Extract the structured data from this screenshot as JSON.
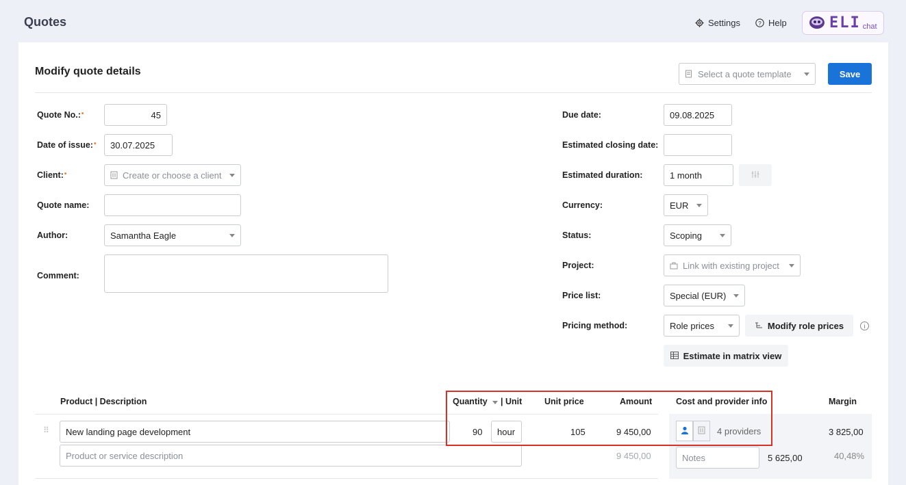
{
  "header": {
    "title": "Quotes",
    "settings_label": "Settings",
    "help_label": "Help",
    "eli_logo_text": "ELI",
    "eli_chat_label": "chat"
  },
  "form": {
    "title": "Modify quote details",
    "template_select_placeholder": "Select a quote template",
    "save_label": "Save",
    "quote_no_label": "Quote No.:",
    "quote_no_value": "45",
    "date_of_issue_label": "Date of issue:",
    "date_of_issue_value": "30.07.2025",
    "client_label": "Client:",
    "client_placeholder": "Create or choose a client",
    "quote_name_label": "Quote name:",
    "quote_name_value": "",
    "author_label": "Author:",
    "author_value": "Samantha Eagle",
    "comment_label": "Comment:",
    "comment_value": "",
    "due_date_label": "Due date:",
    "due_date_value": "09.08.2025",
    "est_closing_label": "Estimated closing date:",
    "est_closing_value": "",
    "est_duration_label": "Estimated duration:",
    "est_duration_value": "1 month",
    "currency_label": "Currency:",
    "currency_value": "EUR",
    "status_label": "Status:",
    "status_value": "Scoping",
    "project_label": "Project:",
    "project_placeholder": "Link with existing project",
    "price_list_label": "Price list:",
    "price_list_value": "Special (EUR)",
    "pricing_method_label": "Pricing method:",
    "pricing_method_value": "Role prices",
    "modify_role_prices_label": "Modify role prices",
    "matrix_view_label": "Estimate in matrix view"
  },
  "table": {
    "headers": {
      "product": "Product | Description",
      "quantity": "Quantity",
      "unit": "| Unit",
      "unit_price": "Unit price",
      "amount": "Amount",
      "cost_info": "Cost and provider info",
      "margin": "Margin"
    },
    "row": {
      "product": "New landing page development",
      "description_placeholder": "Product or service description",
      "quantity": "90",
      "unit": "hour",
      "unit_price": "105",
      "amount": "9 450,00",
      "amount_secondary": "9 450,00",
      "providers": "4 providers",
      "notes_placeholder": "Notes",
      "cost": "5 625,00",
      "margin": "3 825,00",
      "margin_pct": "40,48%"
    }
  },
  "colors": {
    "primary": "#1a73d9",
    "required_marker": "#f07b2c",
    "highlight_frame": "#d93025"
  }
}
